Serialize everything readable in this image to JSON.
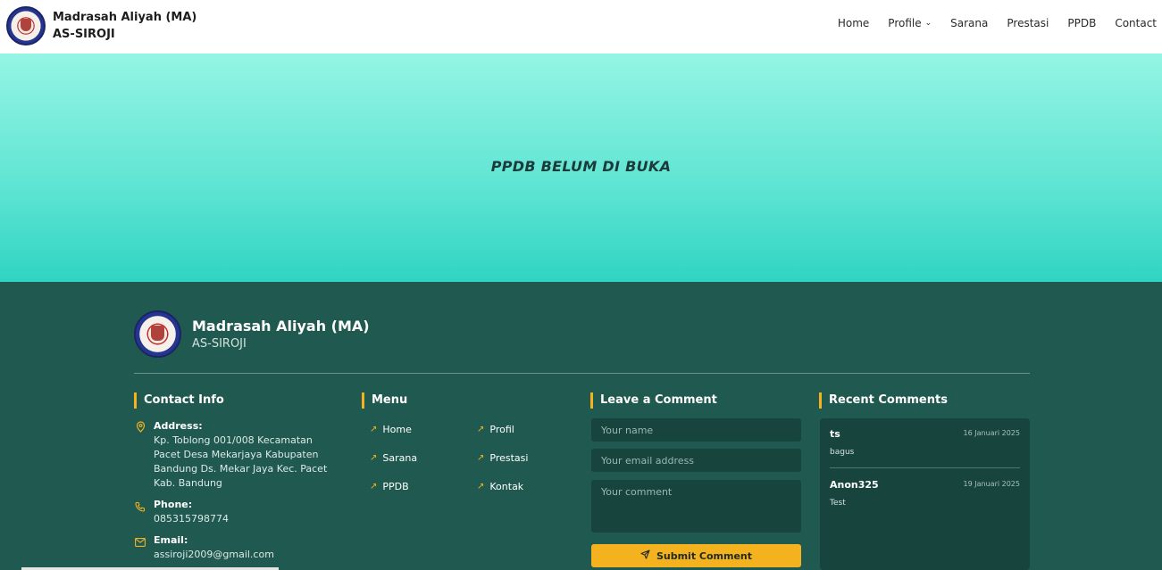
{
  "header": {
    "brand_line1": "Madrasah Aliyah (MA)",
    "brand_line2": "AS-SIROJI",
    "nav": [
      "Home",
      "Profile",
      "Sarana",
      "Prestasi",
      "PPDB",
      "Contact"
    ]
  },
  "hero": {
    "title": "PPDB BELUM DI BUKA"
  },
  "footer": {
    "brand_name": "Madrasah Aliyah (MA)",
    "brand_sub": "AS-SIROJI",
    "contact": {
      "heading": "Contact Info",
      "address_label": "Address:",
      "address_value": "Kp. Toblong 001/008 Kecamatan Pacet Desa Mekarjaya Kabupaten Bandung Ds. Mekar Jaya Kec. Pacet Kab. Bandung",
      "phone_label": "Phone:",
      "phone_value": "085315798774",
      "email_label": "Email:",
      "email_value": "assiroji2009@gmail.com"
    },
    "menu": {
      "heading": "Menu",
      "links": [
        "Home",
        "Profil",
        "Sarana",
        "Prestasi",
        "PPDB",
        "Kontak"
      ]
    },
    "comment_form": {
      "heading": "Leave a Comment",
      "name_placeholder": "Your name",
      "email_placeholder": "Your email address",
      "comment_placeholder": "Your comment",
      "submit_label": "Submit Comment"
    },
    "recent": {
      "heading": "Recent Comments",
      "items": [
        {
          "name": "ts",
          "date": "16 Januari 2025",
          "text": "bagus"
        },
        {
          "name": "Anon325",
          "date": "19 Januari 2025",
          "text": "Test"
        }
      ]
    }
  },
  "colors": {
    "accent": "#f5b21f",
    "footer_bg": "#1f5950",
    "hero_top": "#95f5e4",
    "hero_bottom": "#30d4c2"
  }
}
